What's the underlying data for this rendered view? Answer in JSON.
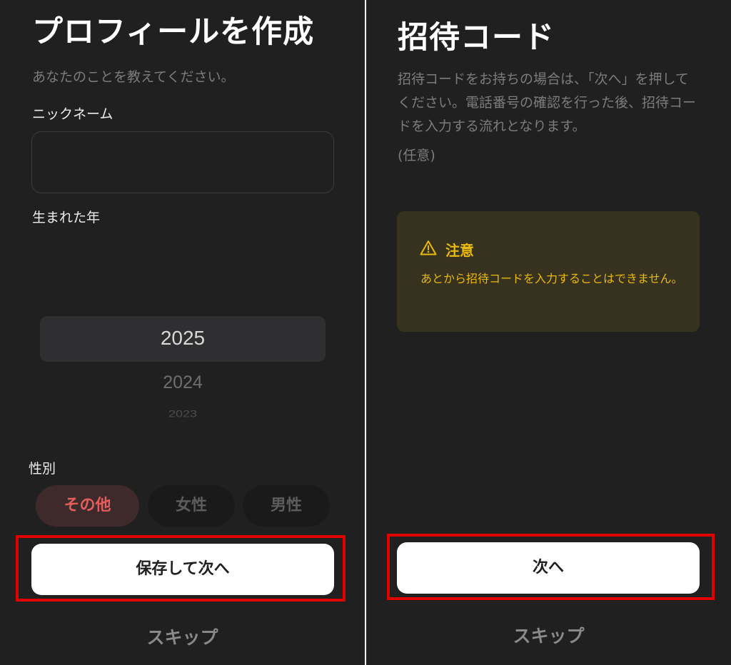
{
  "left_screen": {
    "title": "プロフィールを作成",
    "subtitle": "あなたのことを教えてください。",
    "nickname": {
      "label": "ニックネーム",
      "value": "",
      "placeholder": ""
    },
    "birth_year": {
      "label": "生まれた年",
      "selected": "2025",
      "next": "2024",
      "next2": "2023"
    },
    "gender": {
      "label": "性別",
      "options": [
        "その他",
        "女性",
        "男性"
      ],
      "selected": "その他"
    },
    "primary_button": "保存して次へ",
    "skip": "スキップ"
  },
  "right_screen": {
    "title": "招待コード",
    "description": "招待コードをお持ちの場合は、「次へ」を押してください。電話番号の確認を行った後、招待コードを入力する流れとなります。",
    "optional": "(任意)",
    "notice": {
      "icon": "warning-icon",
      "title": "注意",
      "text": "あとから招待コードを入力することはできません。"
    },
    "primary_button": "次へ",
    "skip": "スキップ"
  },
  "colors": {
    "background": "#202020",
    "selected_pill_bg": "#3e2a2a",
    "selected_pill_text": "#e35d5d",
    "pill_bg": "#1a1a1a",
    "highlight": "#e00000",
    "notice_bg": "#37321f",
    "notice_text": "#eab90e"
  }
}
